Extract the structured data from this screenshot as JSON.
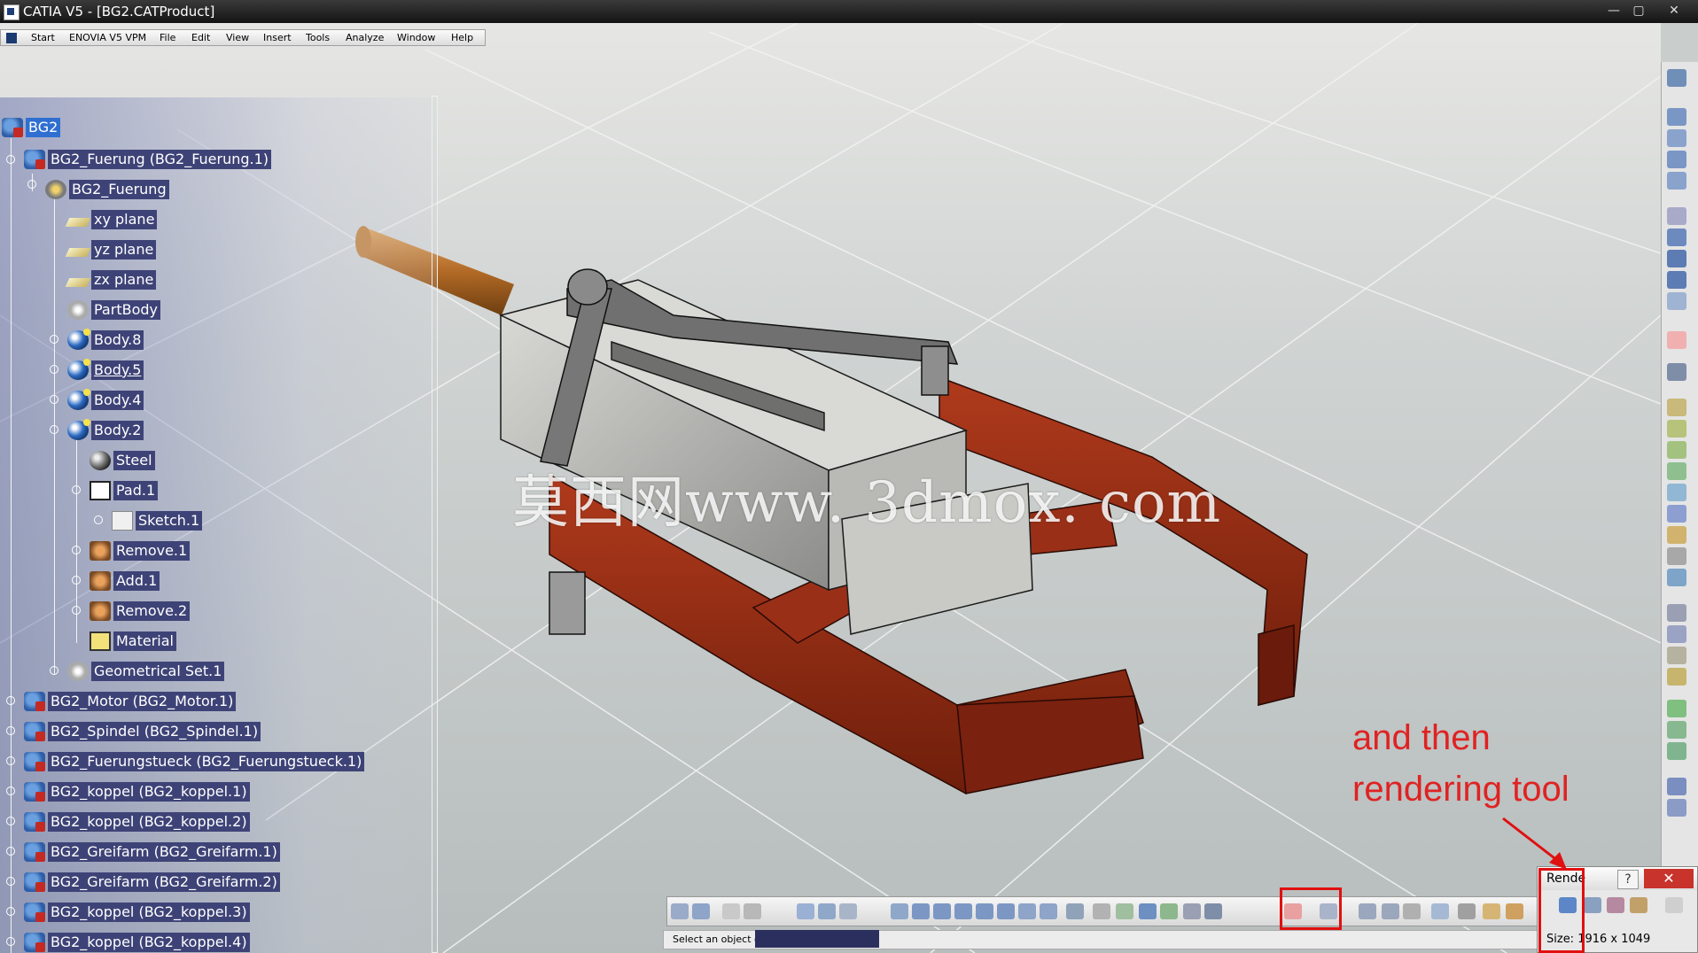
{
  "window": {
    "title": "CATIA V5 - [BG2.CATProduct]",
    "minimize": "—",
    "maximize": "▢",
    "close": "✕"
  },
  "menubar": {
    "items": [
      "Start",
      "ENOVIA V5 VPM",
      "File",
      "Edit",
      "View",
      "Insert",
      "Tools",
      "Analyze",
      "Window",
      "Help"
    ]
  },
  "tree": {
    "root": "BG2",
    "nodes": [
      {
        "label": "BG2_Fuerung (BG2_Fuerung.1)",
        "icon": "product-icon"
      },
      {
        "label": "BG2_Fuerung",
        "icon": "part-icon"
      },
      {
        "label": "xy plane",
        "icon": "plane-icon"
      },
      {
        "label": "yz plane",
        "icon": "plane-icon"
      },
      {
        "label": "zx plane",
        "icon": "plane-icon"
      },
      {
        "label": "PartBody",
        "icon": "partbody-icon"
      },
      {
        "label": "Body.8",
        "icon": "body-icon"
      },
      {
        "label": "Body.5",
        "icon": "body-icon"
      },
      {
        "label": "Body.4",
        "icon": "body-icon"
      },
      {
        "label": "Body.2",
        "icon": "body-icon"
      },
      {
        "label": "Steel",
        "icon": "material-sphere-icon"
      },
      {
        "label": "Pad.1",
        "icon": "pad-icon"
      },
      {
        "label": "Sketch.1",
        "icon": "sketch-icon"
      },
      {
        "label": "Remove.1",
        "icon": "remove-icon"
      },
      {
        "label": "Add.1",
        "icon": "add-icon"
      },
      {
        "label": "Remove.2",
        "icon": "remove-icon"
      },
      {
        "label": "Material",
        "icon": "material-icon"
      },
      {
        "label": "Geometrical Set.1",
        "icon": "geometrical-set-icon"
      },
      {
        "label": "BG2_Motor (BG2_Motor.1)",
        "icon": "product-icon"
      },
      {
        "label": "BG2_Spindel (BG2_Spindel.1)",
        "icon": "product-icon"
      },
      {
        "label": "BG2_Fuerungstueck (BG2_Fuerungstueck.1)",
        "icon": "product-icon"
      },
      {
        "label": "BG2_koppel (BG2_koppel.1)",
        "icon": "product-icon"
      },
      {
        "label": "BG2_koppel (BG2_koppel.2)",
        "icon": "product-icon"
      },
      {
        "label": "BG2_Greifarm (BG2_Greifarm.1)",
        "icon": "product-icon"
      },
      {
        "label": "BG2_Greifarm (BG2_Greifarm.2)",
        "icon": "product-icon"
      },
      {
        "label": "BG2_koppel (BG2_koppel.3)",
        "icon": "product-icon"
      },
      {
        "label": "BG2_koppel (BG2_koppel.4)",
        "icon": "product-icon"
      }
    ]
  },
  "watermark": "莫西网www. 3dmox. com",
  "annotation": {
    "line1": "and then",
    "line2": "rendering tool",
    "color": "#e02222"
  },
  "status": {
    "prompt": "Select an object or a command"
  },
  "render_dialog": {
    "title": "Rende",
    "help": "?",
    "close": "✕",
    "size": "Size: 1916 x 1049"
  },
  "colors": {
    "tree_label_bg": "#3e4377",
    "selected": "#2f6fd1",
    "part_red": "#8e2a16",
    "floor": "#c9cecd"
  }
}
